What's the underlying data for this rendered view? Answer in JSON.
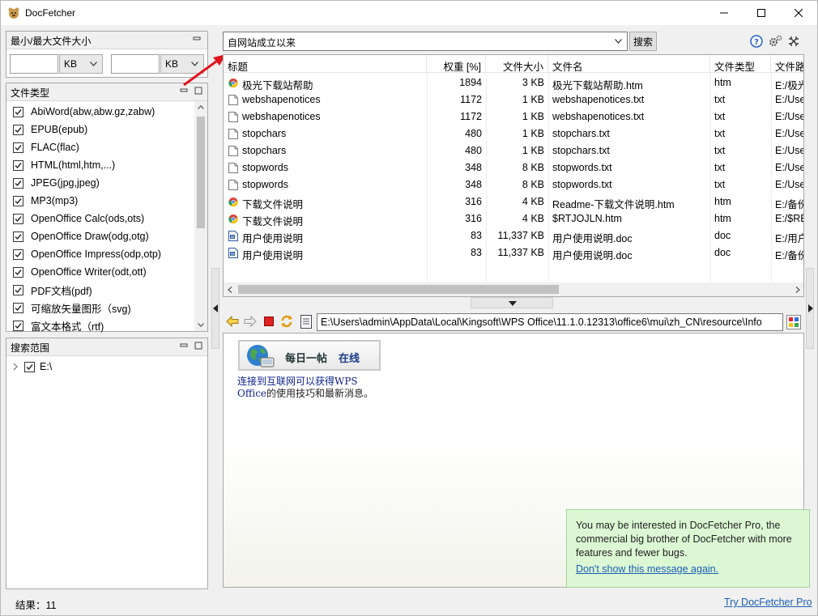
{
  "window": {
    "title": "DocFetcher"
  },
  "size_panel": {
    "title": "最小/最大文件大小",
    "min_value": "",
    "min_unit": "KB",
    "max_value": "",
    "max_unit": "KB"
  },
  "filetype_panel": {
    "title": "文件类型",
    "items": [
      {
        "label": "AbiWord(abw,abw.gz,zabw)",
        "checked": true
      },
      {
        "label": "EPUB(epub)",
        "checked": true
      },
      {
        "label": "FLAC(flac)",
        "checked": true
      },
      {
        "label": "HTML(html,htm,...)",
        "checked": true
      },
      {
        "label": "JPEG(jpg,jpeg)",
        "checked": true
      },
      {
        "label": "MP3(mp3)",
        "checked": true
      },
      {
        "label": "OpenOffice Calc(ods,ots)",
        "checked": true
      },
      {
        "label": "OpenOffice Draw(odg,otg)",
        "checked": true
      },
      {
        "label": "OpenOffice Impress(odp,otp)",
        "checked": true
      },
      {
        "label": "OpenOffice Writer(odt,ott)",
        "checked": true
      },
      {
        "label": "PDF文档(pdf)",
        "checked": true
      },
      {
        "label": "可缩放矢量图形（svg)",
        "checked": true
      },
      {
        "label": "富文本格式（rtf)",
        "checked": true
      }
    ]
  },
  "scope_panel": {
    "title": "搜索范围",
    "items": [
      {
        "label": "E:\\",
        "checked": true
      }
    ]
  },
  "status": {
    "text": "结果：11"
  },
  "search": {
    "query": "自网站成立以来",
    "button": "搜索"
  },
  "results": {
    "columns": [
      "标题",
      "权重 [%]",
      "文件大小",
      "文件名",
      "文件类型",
      "文件路"
    ],
    "rows": [
      {
        "title": "极光下载站帮助",
        "weight": "1894",
        "size": "3 KB",
        "filename": "极光下载站帮助.htm",
        "type": "htm",
        "path": "E:/极光",
        "icon": "chrome-icon"
      },
      {
        "title": "webshapenotices",
        "weight": "1172",
        "size": "1 KB",
        "filename": "webshapenotices.txt",
        "type": "txt",
        "path": "E:/Use",
        "icon": "text-file-icon"
      },
      {
        "title": "webshapenotices",
        "weight": "1172",
        "size": "1 KB",
        "filename": "webshapenotices.txt",
        "type": "txt",
        "path": "E:/Use",
        "icon": "text-file-icon"
      },
      {
        "title": "stopchars",
        "weight": "480",
        "size": "1 KB",
        "filename": "stopchars.txt",
        "type": "txt",
        "path": "E:/Use",
        "icon": "text-file-icon"
      },
      {
        "title": "stopchars",
        "weight": "480",
        "size": "1 KB",
        "filename": "stopchars.txt",
        "type": "txt",
        "path": "E:/Use",
        "icon": "text-file-icon"
      },
      {
        "title": "stopwords",
        "weight": "348",
        "size": "8 KB",
        "filename": "stopwords.txt",
        "type": "txt",
        "path": "E:/Use",
        "icon": "text-file-icon"
      },
      {
        "title": "stopwords",
        "weight": "348",
        "size": "8 KB",
        "filename": "stopwords.txt",
        "type": "txt",
        "path": "E:/Use",
        "icon": "text-file-icon"
      },
      {
        "title": "下载文件说明",
        "weight": "316",
        "size": "4 KB",
        "filename": "Readme-下载文件说明.htm",
        "type": "htm",
        "path": "E:/备份",
        "icon": "chrome-icon"
      },
      {
        "title": "下载文件说明",
        "weight": "316",
        "size": "4 KB",
        "filename": "$RTJOJLN.htm",
        "type": "htm",
        "path": "E:/$RE",
        "icon": "chrome-icon"
      },
      {
        "title": "用户使用说明",
        "weight": "83",
        "size": "11,337 KB",
        "filename": "用户使用说明.doc",
        "type": "doc",
        "path": "E:/用户",
        "icon": "word-doc-icon"
      },
      {
        "title": "用户使用说明",
        "weight": "83",
        "size": "11,337 KB",
        "filename": "用户使用说明.doc",
        "type": "doc",
        "path": "E:/备份",
        "icon": "word-doc-icon"
      }
    ]
  },
  "preview": {
    "path": "E:\\Users\\admin\\AppData\\Local\\Kingsoft\\WPS Office\\11.1.0.12313\\office6\\mui\\zh_CN\\resource\\Info",
    "banner_title": "每日一帖",
    "banner_online": "在线",
    "line1": "连接到互联网可以获得WPS",
    "line2_a": "Office",
    "line2_b": "的使用技巧和最新消息。"
  },
  "notice": {
    "text": "You may be interested in DocFetcher Pro, the commercial big brother of DocFetcher with more features and fewer bugs.",
    "dismiss_link": "Don't show this message again.",
    "try_link": "Try DocFetcher Pro"
  },
  "colors": {
    "link": "#1a5fb4",
    "highlight_green": "#dcf7d4",
    "annotation_arrow": "#e0141e"
  }
}
